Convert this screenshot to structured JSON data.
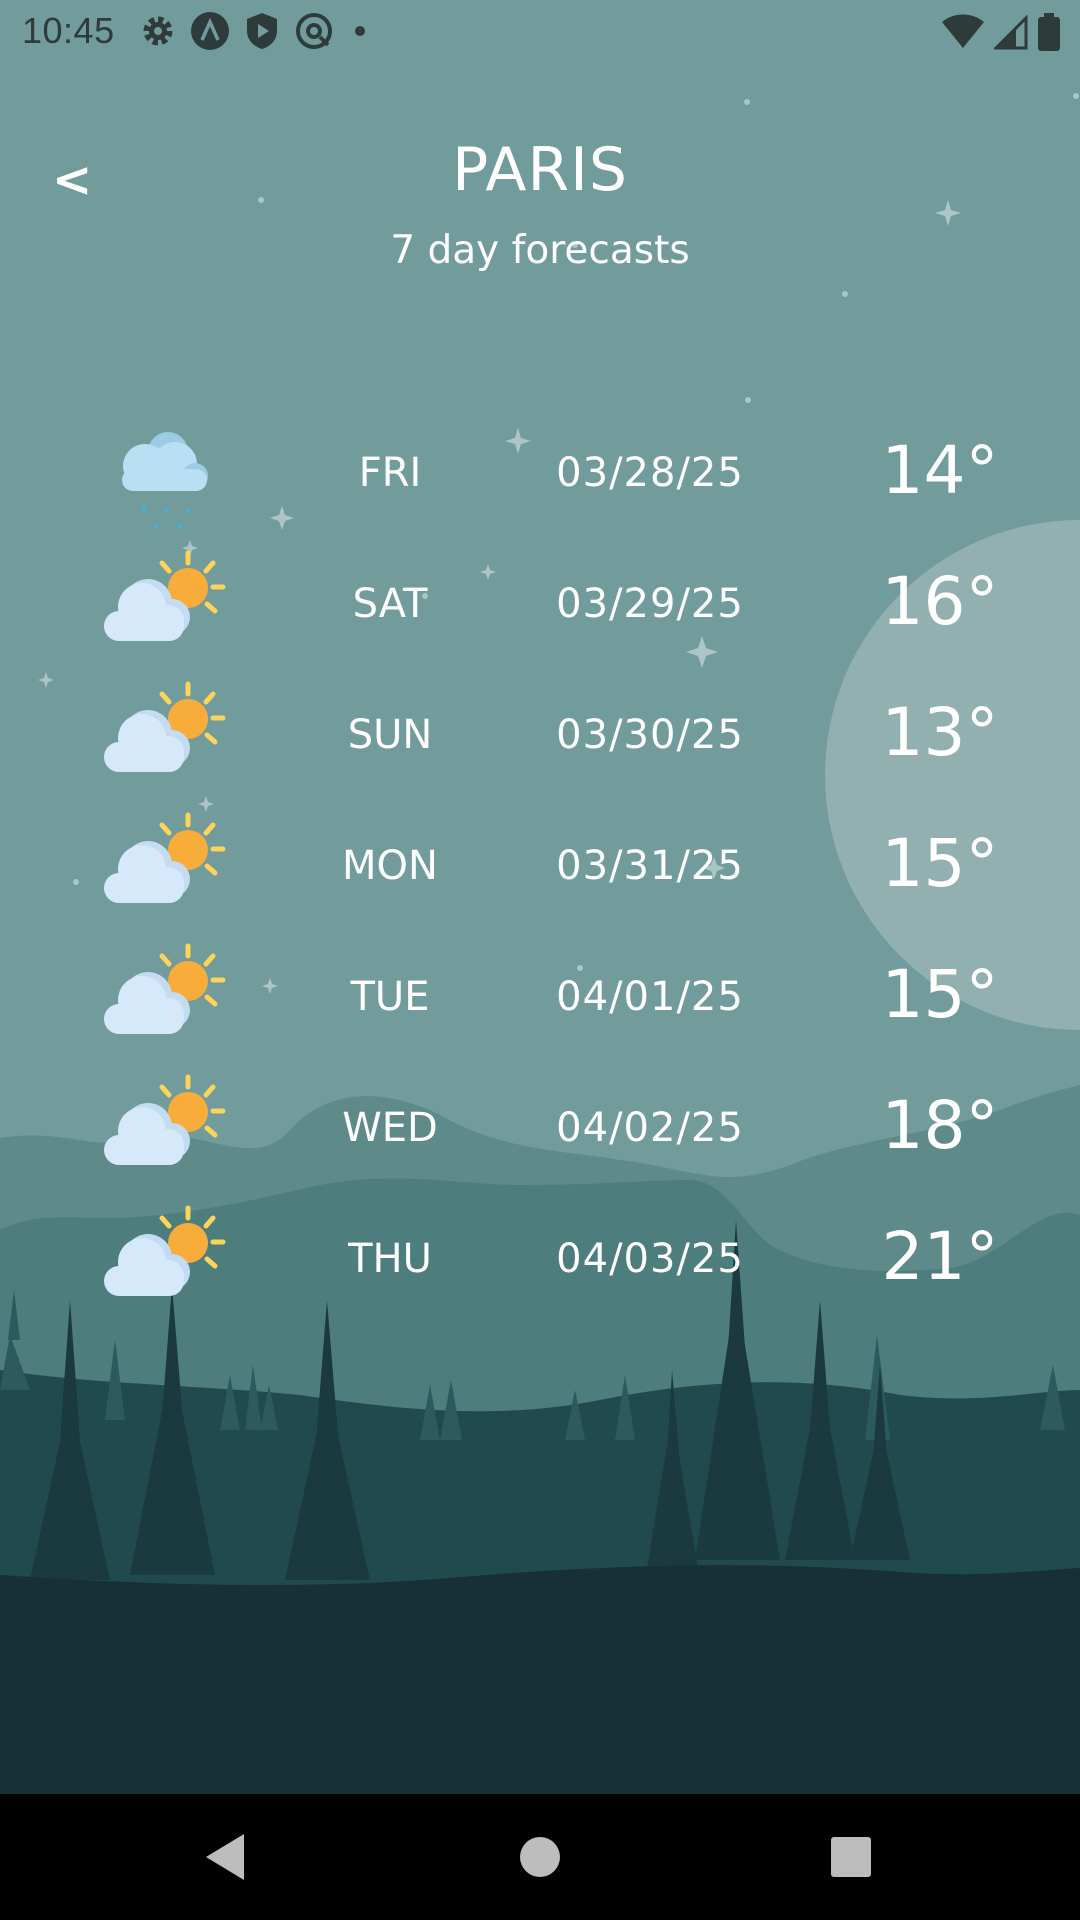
{
  "status_bar": {
    "time": "10:45",
    "left_icons": [
      "gear-icon",
      "a-circle-icon",
      "shield-play-icon",
      "at-circle-icon",
      "dot-icon"
    ],
    "right_icons": [
      "wifi-icon",
      "signal-icon",
      "battery-icon"
    ]
  },
  "header": {
    "back_label": "<",
    "city": "PARIS",
    "subtitle": "7 day forecasts"
  },
  "forecast": [
    {
      "day": "FRI",
      "date": "03/28/25",
      "temp": "14°",
      "icon": "rain-cloud-icon"
    },
    {
      "day": "SAT",
      "date": "03/29/25",
      "temp": "16°",
      "icon": "partly-sunny-icon"
    },
    {
      "day": "SUN",
      "date": "03/30/25",
      "temp": "13°",
      "icon": "partly-sunny-icon"
    },
    {
      "day": "MON",
      "date": "03/31/25",
      "temp": "15°",
      "icon": "partly-sunny-icon"
    },
    {
      "day": "TUE",
      "date": "04/01/25",
      "temp": "15°",
      "icon": "partly-sunny-icon"
    },
    {
      "day": "WED",
      "date": "04/02/25",
      "temp": "18°",
      "icon": "partly-sunny-icon"
    },
    {
      "day": "THU",
      "date": "04/03/25",
      "temp": "21°",
      "icon": "partly-sunny-icon"
    }
  ],
  "nav_bar": {
    "buttons": [
      "back-triangle-icon",
      "home-circle-icon",
      "recents-square-icon"
    ]
  },
  "colors": {
    "sky": "#729c9c",
    "moon": "#93b0b0",
    "hill_back": "#5f8a8a",
    "hill_mid": "#4e7d7d",
    "forest": "#214a4e",
    "forest_dark": "#163036",
    "text": "#ffffff",
    "sun": "#f8ad3b",
    "sun_rays": "#fcd45a",
    "cloud": "#d6e9fa",
    "rain_cloud": "#b9e0f2",
    "rain": "#3ab4ea"
  }
}
